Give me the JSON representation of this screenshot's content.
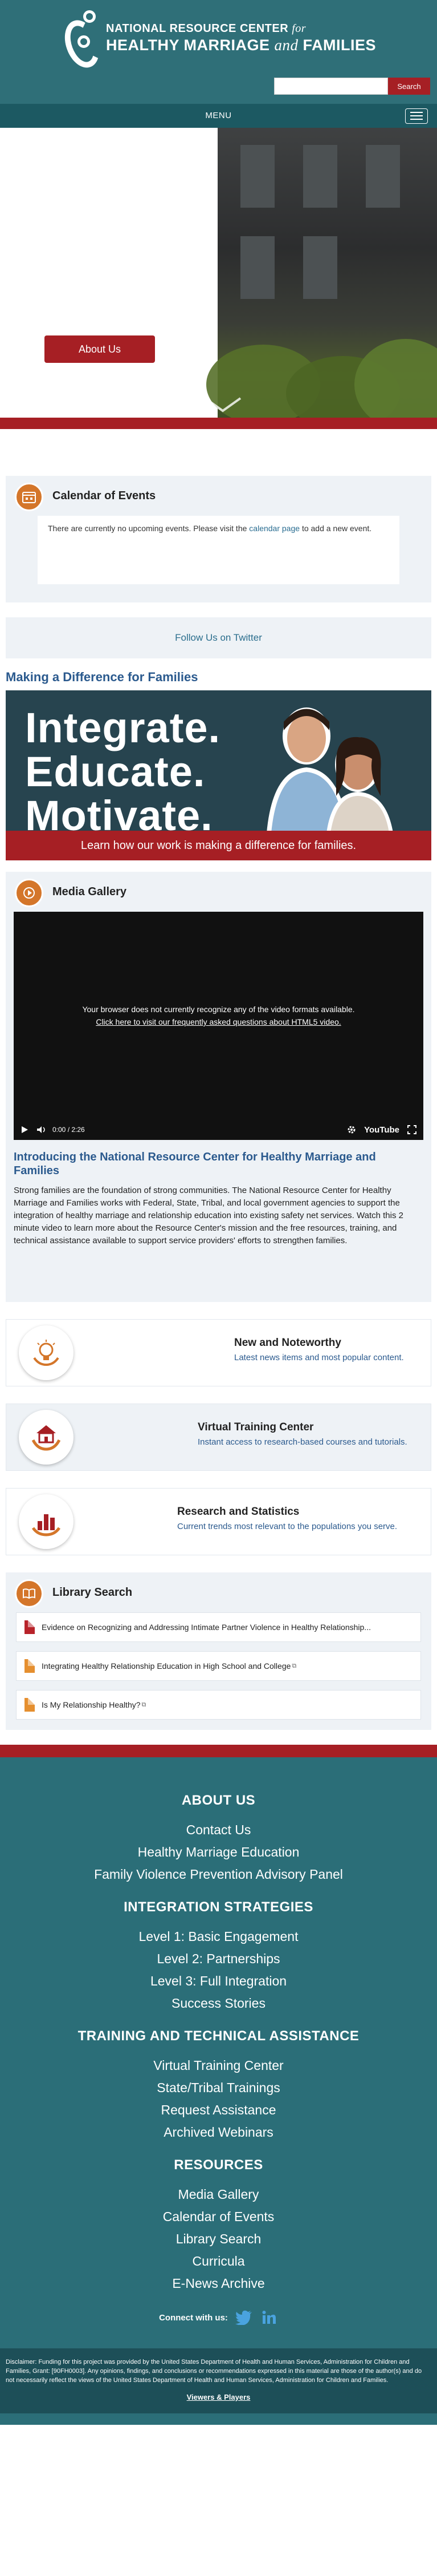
{
  "header": {
    "logo_line1": "NATIONAL RESOURCE CENTER",
    "logo_line1_italic": "for",
    "logo_line2": "HEALTHY MARRIAGE",
    "logo_line2_italic": "and",
    "logo_line2_end": "FAMILIES",
    "search_placeholder": "",
    "search_button": "Search",
    "menu_label": "MENU"
  },
  "hero": {
    "about_button": "About Us"
  },
  "calendar": {
    "title": "Calendar of Events",
    "message_before": "There are currently no upcoming events. Please visit the",
    "message_link": "calendar page",
    "message_after": "to add a new event."
  },
  "follow": {
    "label": "Follow Us on Twitter"
  },
  "difference": {
    "title": "Making a Difference for Families",
    "banner_line1": "Integrate.",
    "banner_line2": "Educate.",
    "banner_line3": "Motivate.",
    "banner_cta": "Learn how our work is making a difference for families."
  },
  "media": {
    "title": "Media Gallery",
    "video_message": "Your browser does not currently recognize any of the video formats available.",
    "video_link": "Click here to visit our frequently asked questions about HTML5 video.",
    "video_time": "0:00 / 2:26",
    "video_brand": "YouTube",
    "intro_title": "Introducing the National Resource Center for Healthy Marriage and Families",
    "intro_body": "Strong families are the foundation of strong communities. The National Resource Center for Healthy Marriage and Families works with Federal, State, Tribal, and local government agencies to support the integration of healthy marriage and relationship education into existing safety net services. Watch this 2 minute video to learn more about the Resource Center's mission and the free resources, training, and technical assistance available to support service providers' efforts to strengthen families."
  },
  "features": [
    {
      "title": "New and Noteworthy",
      "desc": "Latest news items and most popular content."
    },
    {
      "title": "Virtual Training Center",
      "desc": "Instant access to research-based courses and tutorials."
    },
    {
      "title": "Research and Statistics",
      "desc": "Current trends most relevant to the populations you serve."
    }
  ],
  "library": {
    "title": "Library Search",
    "items": [
      {
        "label": "Evidence on Recognizing and Addressing Intimate Partner Violence in Healthy Relationship...",
        "kind": "pdf"
      },
      {
        "label": "Integrating Healthy Relationship Education in High School and College",
        "kind": "doc"
      },
      {
        "label": "Is My Relationship Healthy?",
        "kind": "doc"
      }
    ]
  },
  "footer": {
    "about_head": "ABOUT US",
    "about_links": [
      "Contact Us",
      "Healthy Marriage Education",
      "Family Violence Prevention Advisory Panel"
    ],
    "integration_head": "INTEGRATION STRATEGIES",
    "integration_links": [
      "Level 1: Basic Engagement",
      "Level 2: Partnerships",
      "Level 3: Full Integration",
      "Success Stories"
    ],
    "training_head": "TRAINING AND TECHNICAL ASSISTANCE",
    "training_links": [
      "Virtual Training Center",
      "State/Tribal Trainings",
      "Request Assistance",
      "Archived Webinars"
    ],
    "resources_head": "RESOURCES",
    "resources_links": [
      "Media Gallery",
      "Calendar of Events",
      "Library Search",
      "Curricula",
      "E-News Archive"
    ],
    "connect_label": "Connect with us:",
    "disclaimer": "Disclaimer: Funding for this project was provided by the United States Department of Health and Human Services, Administration for Children and Families, Grant: [90FH0003]. Any opinions, findings, and conclusions or recommendations expressed in this material are those of the author(s) and do not necessarily reflect the views of the United States Department of Health and Human Services, Administration for Children and Families.",
    "viewers_link": "Viewers & Players"
  },
  "colors": {
    "teal_header": "#2f6f78",
    "teal_menu": "#1c5962",
    "brand_red": "#a61f24",
    "accent_orange": "#d4762a",
    "link_blue": "#2b5a8e"
  }
}
